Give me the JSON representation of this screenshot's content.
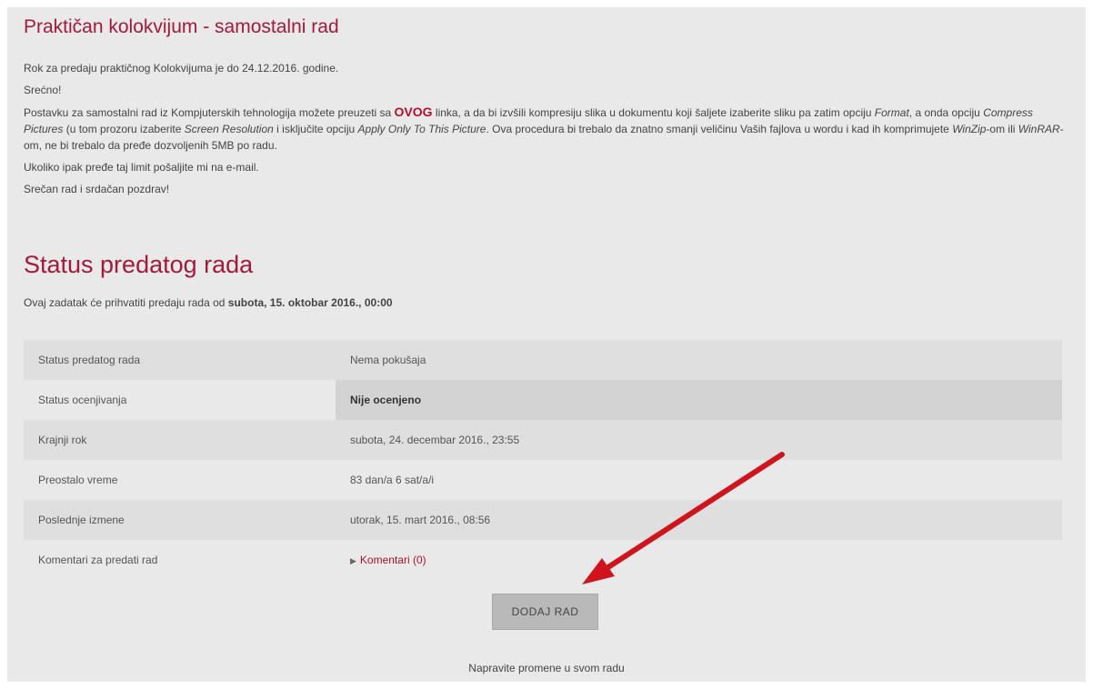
{
  "page_title": "Praktičan kolokvijum - samostalni rad",
  "intro": {
    "deadline_text": "Rok za predaju praktičnog Kolokvijuma je do 24.12.2016. godine.",
    "good_luck": "Srećno!",
    "p3_a": "Postavku za samostalni rad iz Kompjuterskih tehnologija možete preuzeti sa ",
    "p3_link": "OVOG",
    "p3_b": " linka, a da bi izvšili kompresiju slika u dokumentu koji šaljete izaberite sliku pa zatim opciju ",
    "p3_format": "Format",
    "p3_c": ", a onda opciju ",
    "p3_compress": "Compress Pictures",
    "p3_d": " (u tom prozoru izaberite ",
    "p3_screen": "Screen Resolution",
    "p3_e": " i isključite opciju ",
    "p3_apply": "Apply Only To This Picture",
    "p3_f": ". Ova procedura bi trebalo da znatno smanji veličinu Vaših fajlova u wordu i kad ih komprimujete ",
    "p3_winzip": "WinZip",
    "p3_g": "-om ili ",
    "p3_winrar": "WinRAR",
    "p3_h": "-om, ne bi trebalo da pređe dozvoljenih 5MB po radu.",
    "limit_text": "Ukoliko ipak pređe taj limit pošaljite mi na e-mail.",
    "regards": "Srečan rad i srdačan pozdrav!"
  },
  "status_section": {
    "heading": "Status predatog rada",
    "sub_prefix": "Ovaj zadatak će prihvatiti predaju rada od ",
    "sub_date": "subota, 15. oktobar 2016., 00:00"
  },
  "status_table": {
    "rows": [
      {
        "label": "Status predatog rada",
        "value": "Nema pokušaja"
      },
      {
        "label": "Status ocenjivanja",
        "value": "Nije ocenjeno"
      },
      {
        "label": "Krajnji rok",
        "value": "subota, 24. decembar 2016., 23:55"
      },
      {
        "label": "Preostalo vreme",
        "value": "83 dan/a 6 sat/a/i"
      },
      {
        "label": "Poslednje izmene",
        "value": "utorak, 15. mart 2016., 08:56"
      },
      {
        "label": "Komentari za predati rad",
        "value": "Komentari (0)"
      }
    ]
  },
  "actions": {
    "add_button": "DODAJ RAD",
    "help_text": "Napravite promene u svom radu"
  },
  "colors": {
    "accent": "#a31a3a",
    "link": "#b0102c",
    "arrow": "#d0141e"
  }
}
